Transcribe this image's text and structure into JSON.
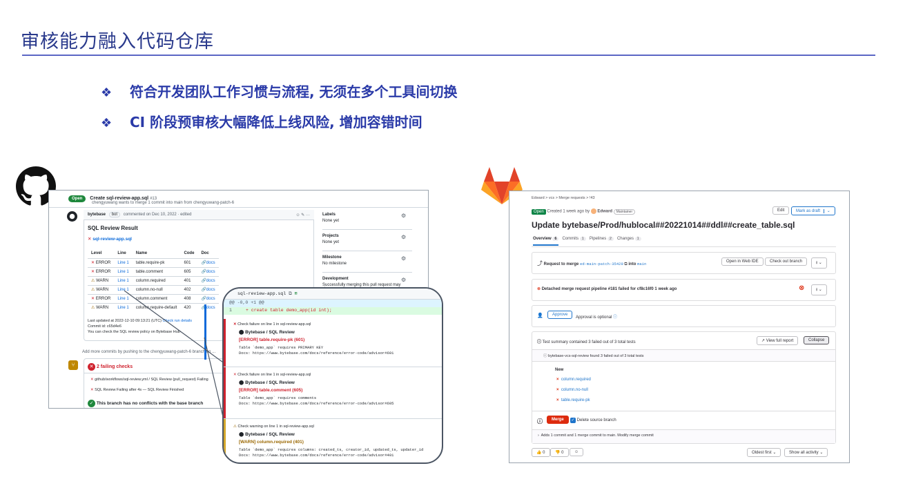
{
  "slide": {
    "title": "审核能力融入代码仓库",
    "bullets": [
      "符合开发团队工作习惯与流程, 无须在多个工具间切换",
      "CI 阶段预审核大幅降低上线风险, 增加容错时间"
    ]
  },
  "github": {
    "state": "Open",
    "pr_title": "Create sql-review-app.sql",
    "pr_number": "#13",
    "pr_sub": "chengyuwang wants to merge 1 commit into main from chengyuwang-patch-6",
    "commenter": "bytebase",
    "bot_badge": "bot",
    "comment_meta": "commented on Dec 10, 2022 · edited",
    "review_title": "SQL Review Result",
    "file_link": "sql-review-app.sql",
    "columns": [
      "Level",
      "Line",
      "Name",
      "Code",
      "Doc"
    ],
    "rows": [
      {
        "level": "ERROR",
        "line": "Line 1",
        "name": "table.require-pk",
        "code": "601",
        "doc": "docs"
      },
      {
        "level": "ERROR",
        "line": "Line 1",
        "name": "table.comment",
        "code": "605",
        "doc": "docs"
      },
      {
        "level": "WARN",
        "line": "Line 1",
        "name": "column.required",
        "code": "401",
        "doc": "docs"
      },
      {
        "level": "WARN",
        "line": "Line 1",
        "name": "column.no-null",
        "code": "402",
        "doc": "docs"
      },
      {
        "level": "ERROR",
        "line": "Line 1",
        "name": "column.comment",
        "code": "408",
        "doc": "docs"
      },
      {
        "level": "WARN",
        "line": "Line 1",
        "name": "column.require-default",
        "code": "420",
        "doc": "docs"
      }
    ],
    "last_updated": "Last updated at 2022-12-10 09:13:21 (UTC)",
    "check_run": "Check run details",
    "commit_id": "Commit id: c65d4e6",
    "policy_note": "You can check the SQL review policy on Bytebase Hub",
    "more_commits": "Add more commits by pushing to the chengyuwang-patch-6 branch on ...",
    "failing_checks": "2 failing checks",
    "check1": "github/workflows/sql-review.yml / SQL Review (pull_request)  Failing",
    "check2": "SQL Review  Failing after 4s — SQL Review Finished",
    "no_conflicts": "This branch has no conflicts with the base branch",
    "sidebar": [
      {
        "label": "Labels",
        "value": "None yet"
      },
      {
        "label": "Projects",
        "value": "None yet"
      },
      {
        "label": "Milestone",
        "value": "No milestone"
      },
      {
        "label": "Development",
        "value": "Successfully merging this pull request may close ..."
      }
    ]
  },
  "magnifier": {
    "file": "sql-review-app.sql",
    "hunk": "@@ -0,0 +1 @@",
    "line_no": "1",
    "code": "+ create table demo_app(id int);",
    "sections": [
      {
        "kind": "error",
        "header": "Check failure on line 1 in sql-review-app.sql",
        "source": "Bytebase / SQL Review",
        "rule": "[ERROR] table.require-pk (601)",
        "msg": "Table `demo_app` requires PRIMARY KEY",
        "docs": "Docs: https://www.bytebase.com/docs/reference/error-code/advisor#601"
      },
      {
        "kind": "error",
        "header": "Check failure on line 1 in sql-review-app.sql",
        "source": "Bytebase / SQL Review",
        "rule": "[ERROR] table.comment (605)",
        "msg": "Table `demo_app` requires comments",
        "docs": "Docs: https://www.bytebase.com/docs/reference/error-code/advisor#605"
      },
      {
        "kind": "warn",
        "header": "Check warning on line 1 in sql-review-app.sql",
        "source": "Bytebase / SQL Review",
        "rule": "[WARN] column.required (401)",
        "msg": "Table `demo_app` requires columns: created_ts, creator_id, updated_ts, updater_id",
        "docs": "Docs: https://www.bytebase.com/docs/reference/error-code/advisor#401"
      }
    ]
  },
  "gitlab": {
    "breadcrumb": "Edward  >  vcs  >  Merge requests  >  !43",
    "state": "Open",
    "created": "Created 1 week ago by",
    "author": "Edward",
    "role": "Maintainer",
    "edit": "Edit",
    "mark_draft": "Mark as draft",
    "title": "Update bytebase/Prod/hublocal##20221014##ddl##create_table.sql",
    "tabs": [
      {
        "label": "Overview",
        "count": "6"
      },
      {
        "label": "Commits",
        "count": "1"
      },
      {
        "label": "Pipelines",
        "count": "2"
      },
      {
        "label": "Changes",
        "count": "1"
      }
    ],
    "request_text": "Request to merge",
    "source_branch": "ed-main-patch-35429",
    "into": "into",
    "target_branch": "main",
    "open_web_ide": "Open in Web IDE",
    "check_out": "Check out branch",
    "pipeline_text": "Detached merge request pipeline #181 failed for cf8c16f0 1 week ago",
    "approve": "Approve",
    "approval_optional": "Approval is optional",
    "test_summary": "Test summary contained 3 failed out of 3 total tests",
    "view_full": "View full report",
    "collapse": "Collapse",
    "suite": "bytebase-vcs-sql-review found 3 failed out of 3 total tests",
    "new_label": "New",
    "failed_tests": [
      "column.required",
      "column.no-null",
      "table.require-pk"
    ],
    "merge": "Merge",
    "delete_source": "Delete source branch",
    "adds": "Adds 1 commit and 1 merge commit to main. Modify merge commit",
    "thumbs_up": "0",
    "thumbs_down": "0",
    "oldest_first": "Oldest first",
    "show_all": "Show all activity"
  }
}
